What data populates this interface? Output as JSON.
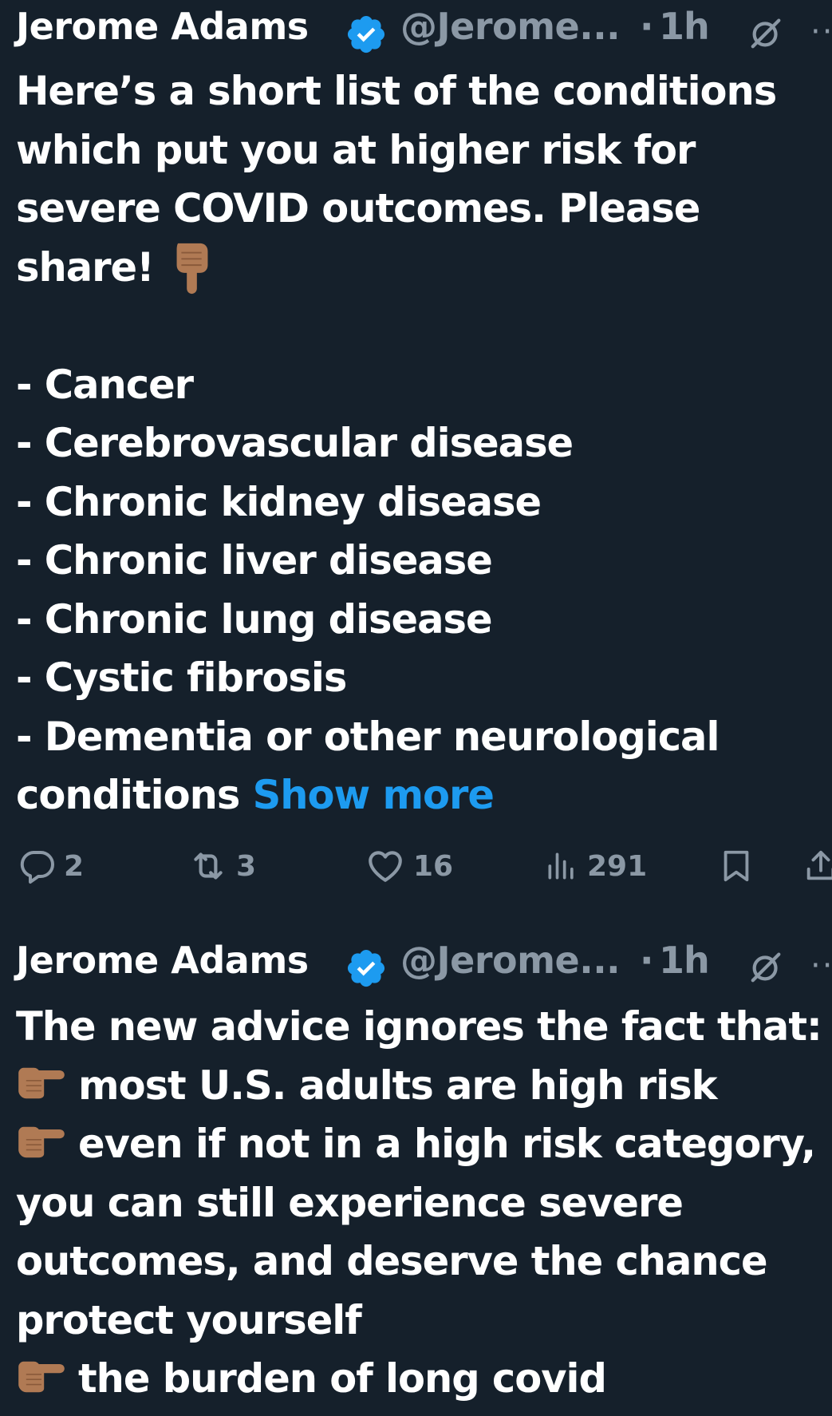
{
  "tweets": [
    {
      "author_name": "Jerome Adams",
      "handle": "@Jerome...",
      "separator": "·",
      "time": "1h",
      "verified_icon": "verified-badge-icon",
      "body_lines": [
        "Here’s a short list of the conditions",
        "which put you at higher risk for",
        "severe COVID outcomes. Please",
        "share!",
        "",
        "- Cancer",
        "- Cerebrovascular disease",
        "- Chronic kidney disease",
        "- Chronic liver disease",
        "- Chronic lung disease",
        "- Cystic fibrosis",
        "- Dementia or other neurological",
        "conditions"
      ],
      "show_more_label": "Show more",
      "actions": {
        "replies": "2",
        "retweets": "3",
        "likes": "16",
        "views": "291"
      }
    },
    {
      "author_name": "Jerome Adams",
      "handle": "@Jerome...",
      "separator": "·",
      "time": "1h",
      "verified_icon": "verified-badge-icon",
      "body_lines": [
        "The new advice ignores the fact that:",
        "most U.S. adults are high risk",
        "even if not in a high risk category,",
        "you can still experience severe",
        "outcomes, and deserve the chance",
        "protect yourself",
        "the burden of long covid"
      ]
    }
  ],
  "colors": {
    "background": "#15202b",
    "text": "#ffffff",
    "muted": "#8b98a5",
    "accent": "#1d9bf0",
    "emoji_skin": "#b07a54"
  },
  "icons": {
    "reply": "reply-icon",
    "retweet": "retweet-icon",
    "like": "heart-icon",
    "views": "views-chart-icon",
    "bookmark": "bookmark-icon",
    "share": "share-icon",
    "grok": "grok-icon",
    "more": "more-options-icon",
    "pointing_down": "backhand-index-pointing-down-emoji",
    "pointing_right": "backhand-index-pointing-right-emoji"
  }
}
